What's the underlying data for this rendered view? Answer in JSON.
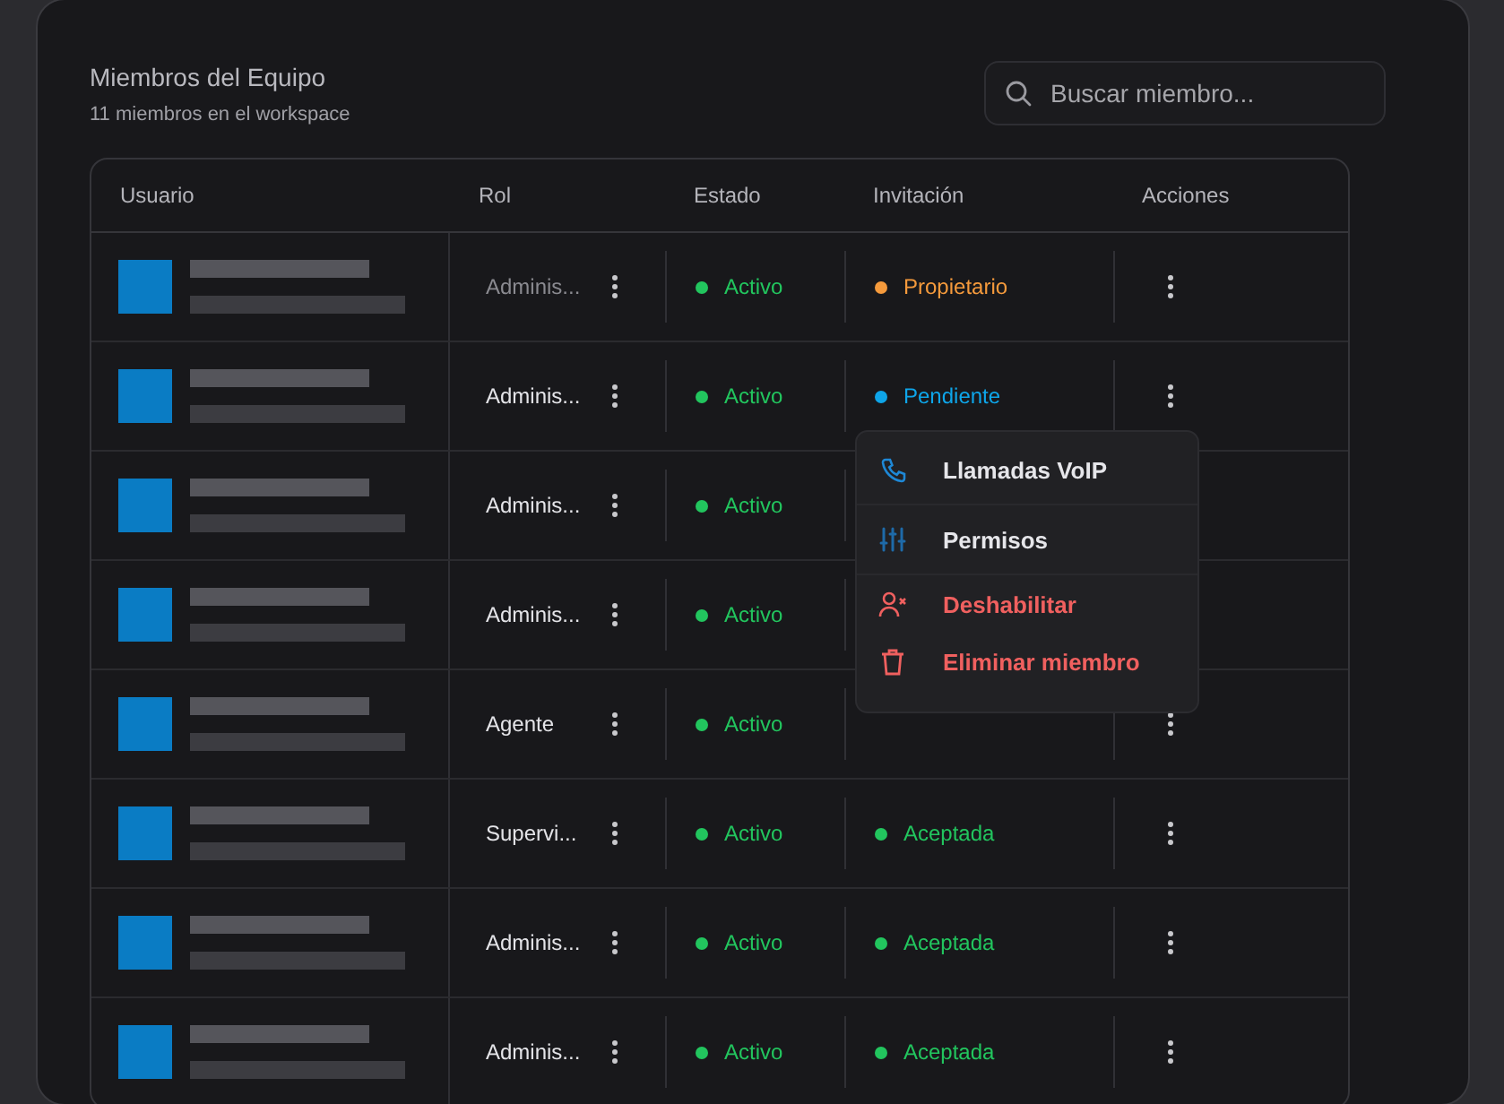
{
  "header": {
    "title": "Miembros del Equipo",
    "subtitle": "11 miembros en el workspace"
  },
  "search": {
    "placeholder": "Buscar miembro..."
  },
  "table": {
    "columns": [
      "Usuario",
      "Rol",
      "Estado",
      "Invitación",
      "Acciones"
    ],
    "rows": [
      {
        "role": "Adminis...",
        "disabled": true,
        "status": {
          "label": "Activo",
          "color": "#22c55e"
        },
        "invitation": {
          "label": "Propietario",
          "color": "#f59a3c"
        }
      },
      {
        "role": "Adminis...",
        "disabled": false,
        "status": {
          "label": "Activo",
          "color": "#22c55e"
        },
        "invitation": {
          "label": "Pendiente",
          "color": "#0ea5e9"
        }
      },
      {
        "role": "Adminis...",
        "disabled": false,
        "status": {
          "label": "Activo",
          "color": "#22c55e"
        }
      },
      {
        "role": "Adminis...",
        "disabled": false,
        "status": {
          "label": "Activo",
          "color": "#22c55e"
        }
      },
      {
        "role": "Agente",
        "disabled": false,
        "status": {
          "label": "Activo",
          "color": "#22c55e"
        }
      },
      {
        "role": "Supervi...",
        "disabled": false,
        "status": {
          "label": "Activo",
          "color": "#22c55e"
        },
        "invitation": {
          "label": "Aceptada",
          "color": "#22c55e"
        }
      },
      {
        "role": "Adminis...",
        "disabled": false,
        "status": {
          "label": "Activo",
          "color": "#22c55e"
        },
        "invitation": {
          "label": "Aceptada",
          "color": "#22c55e"
        }
      },
      {
        "role": "Adminis...",
        "disabled": false,
        "status": {
          "label": "Activo",
          "color": "#22c55e"
        },
        "invitation": {
          "label": "Aceptada",
          "color": "#22c55e"
        }
      }
    ]
  },
  "menu": {
    "items": [
      {
        "label": "Llamadas VoIP",
        "kind": "phone",
        "danger": false
      },
      {
        "label": "Permisos",
        "kind": "sliders",
        "danger": false
      },
      {
        "label": "Deshabilitar",
        "kind": "user-x",
        "danger": true
      },
      {
        "label": "Eliminar miembro",
        "kind": "trash",
        "danger": true
      }
    ]
  }
}
